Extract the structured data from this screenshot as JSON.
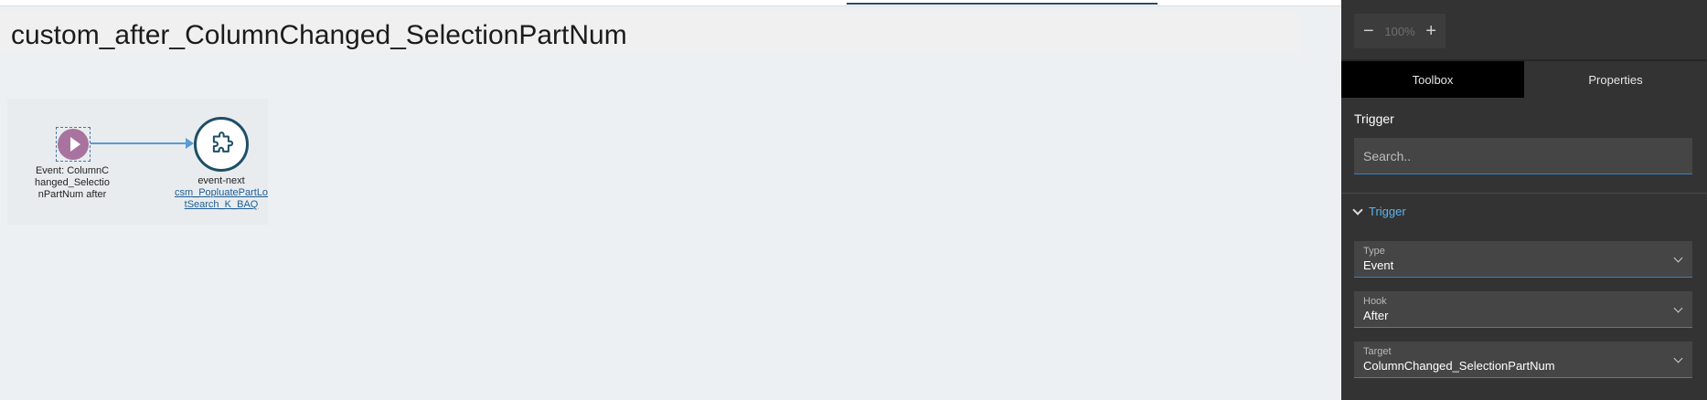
{
  "canvas": {
    "flow_title": "custom_after_ColumnChanged_SelectionPartNum",
    "start_node": {
      "label": "Event: ColumnChanged_SelectionPartNum after"
    },
    "next_node": {
      "label": "event-next",
      "link": "csm_PopluatePartLotSearch_K_BAQ"
    }
  },
  "panel": {
    "zoom": {
      "minus": "−",
      "value": "100%",
      "plus": "+"
    },
    "tabs": [
      {
        "label": "Toolbox",
        "active": true
      },
      {
        "label": "Properties",
        "active": false
      }
    ],
    "section_label": "Trigger",
    "search": {
      "placeholder": "Search.."
    },
    "accordion_label": "Trigger",
    "fields": [
      {
        "label": "Type",
        "value": "Event"
      },
      {
        "label": "Hook",
        "value": "After"
      },
      {
        "label": "Target",
        "value": "ColumnChanged_SelectionPartNum"
      }
    ]
  },
  "colors": {
    "panel_bg": "#333333",
    "accent": "#5cb3ee",
    "start_node": "#a8739e",
    "next_node_border": "#1d4f67",
    "edge": "#5b9bd5"
  }
}
